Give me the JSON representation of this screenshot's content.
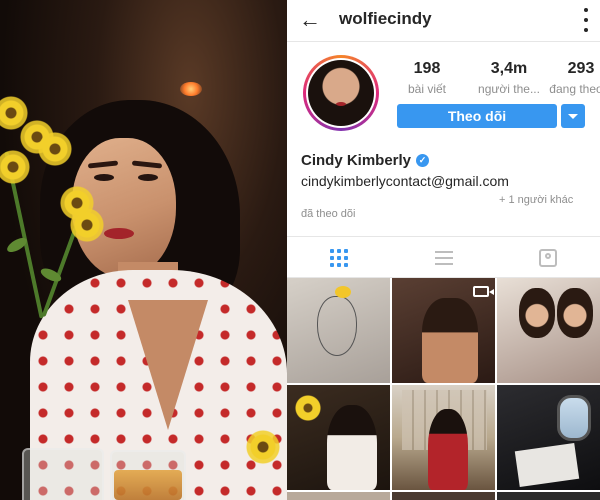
{
  "profile": {
    "username": "wolfiecindy",
    "full_name": "Cindy Kimberly",
    "email": "cindykimberlycontact@gmail.com",
    "mutual_followers": "+ 1 người khác",
    "followed_by_text": "đã theo dõi"
  },
  "stats": {
    "posts": {
      "count": "198",
      "label": "bài viết"
    },
    "followers": {
      "count": "3,4m",
      "label": "người the..."
    },
    "following": {
      "count": "293",
      "label": "đang theo..."
    }
  },
  "actions": {
    "follow_label": "Theo dõi"
  },
  "icons": {
    "back": "back-arrow-icon",
    "more": "more-vertical-icon",
    "verified": "verified-badge-icon",
    "grid_tab": "grid-icon",
    "list_tab": "list-icon",
    "tagged_tab": "tagged-icon",
    "video": "video-icon"
  },
  "colors": {
    "accent": "#3897f0",
    "text": "#262626",
    "muted": "#8e8e8e"
  }
}
